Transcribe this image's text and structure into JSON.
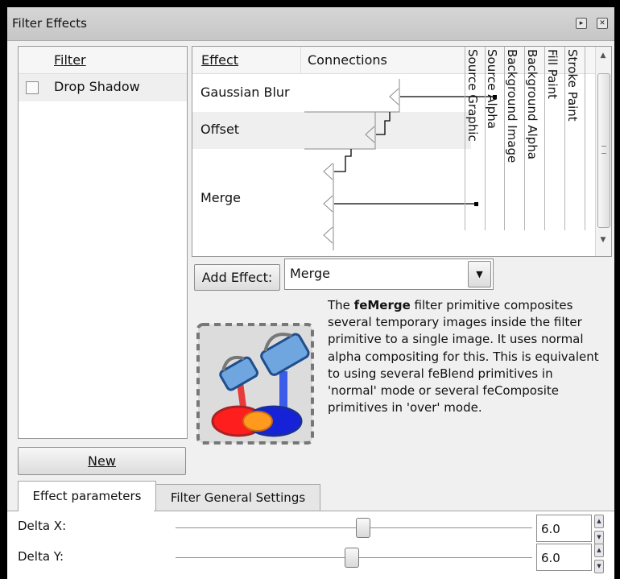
{
  "window": {
    "title": "Filter Effects",
    "btn_dock": "▸",
    "btn_close": "✕"
  },
  "filter_list": {
    "header": "Filter",
    "items": [
      {
        "label": "Drop Shadow",
        "checked": false
      }
    ],
    "new_button": "New"
  },
  "effects": {
    "col_effect": "Effect",
    "col_connections": "Connections",
    "rows": [
      "Gaussian Blur",
      "Offset",
      "Merge"
    ],
    "inputs": [
      "Source Graphic",
      "Source Alpha",
      "Background Image",
      "Background Alpha",
      "Fill Paint",
      "Stroke Paint"
    ]
  },
  "add_effect": {
    "button": "Add Effect:",
    "selected": "Merge"
  },
  "description": {
    "term": "feMerge",
    "prefix": "The ",
    "text": " filter primitive composites several temporary images inside the filter primitive to a single image. It uses normal alpha compositing for this. This is equivalent to using several feBlend primitives in 'normal' mode or several feComposite primitives in 'over' mode."
  },
  "tabs": [
    "Effect parameters",
    "Filter General Settings"
  ],
  "params": [
    {
      "label": "Delta X:",
      "value": "6.0"
    },
    {
      "label": "Delta Y:",
      "value": "6.0"
    }
  ]
}
